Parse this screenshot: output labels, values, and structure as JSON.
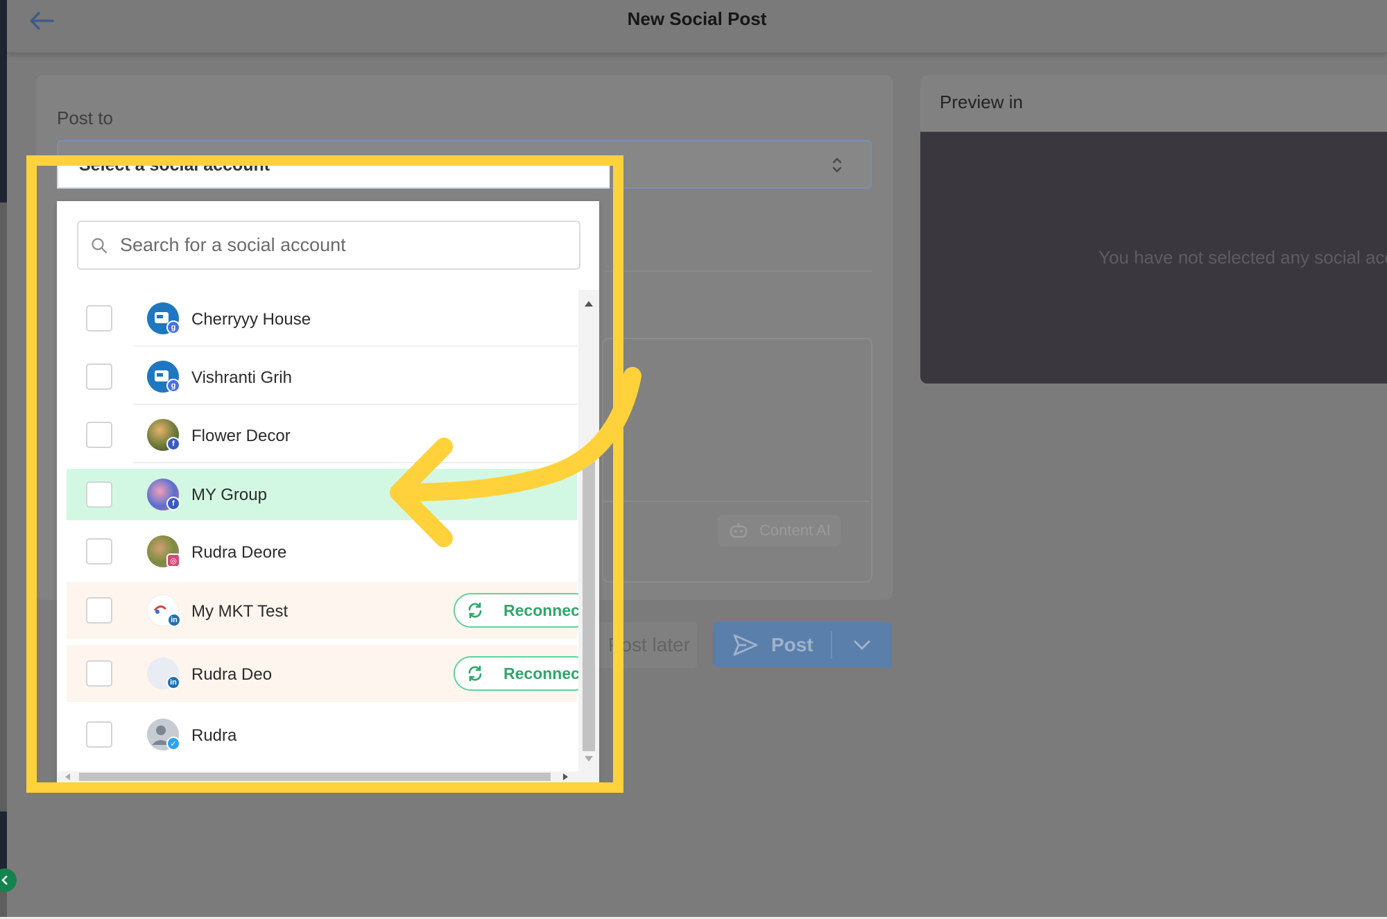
{
  "header": {
    "title": "New Social Post",
    "back_icon": "arrow-left-icon"
  },
  "compose": {
    "post_to_label": "Post to",
    "select_placeholder": "Select a social account",
    "content_ai_label": "Content AI",
    "schedule_label": "Post later",
    "post_label": "Post"
  },
  "preview": {
    "label": "Preview in",
    "empty_message": "You have not selected any social account"
  },
  "dropdown": {
    "search_placeholder": "Search for a social account",
    "reconnect_label": "Reconnect",
    "accounts": [
      {
        "name": "Cherryyy House",
        "network": "google-business",
        "state": "normal"
      },
      {
        "name": "Vishranti Grih",
        "network": "google-business",
        "state": "normal"
      },
      {
        "name": "Flower Decor",
        "network": "facebook",
        "state": "normal"
      },
      {
        "name": "MY Group",
        "network": "facebook",
        "state": "highlighted"
      },
      {
        "name": "Rudra Deore",
        "network": "instagram",
        "state": "normal"
      },
      {
        "name": "My MKT Test",
        "network": "linkedin",
        "state": "needs-reconnect"
      },
      {
        "name": "Rudra Deo",
        "network": "linkedin",
        "state": "needs-reconnect"
      },
      {
        "name": "Rudra",
        "network": "twitter",
        "state": "normal"
      }
    ]
  },
  "colors": {
    "highlight_frame": "#ffd23c",
    "selected_row": "#d2f8e3",
    "reconnect_row": "#fdf5ee",
    "reconnect_green": "#2ea86a",
    "post_button": "#5b7fab"
  }
}
